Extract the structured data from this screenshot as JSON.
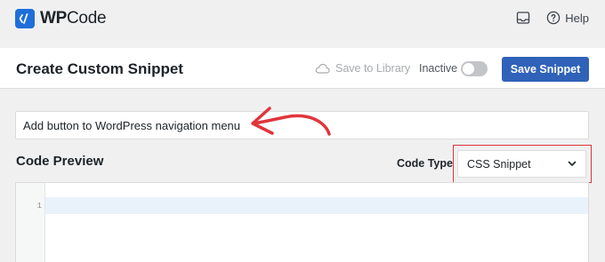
{
  "brand": {
    "prefix": "WP",
    "suffix": "Code",
    "accent": "#1e6fd9"
  },
  "topbar": {
    "inbox_icon": "inbox-icon",
    "help_icon": "question-circle-icon",
    "help_label": "Help"
  },
  "header": {
    "title": "Create Custom Snippet",
    "save_library_label": "Save to Library",
    "status_label": "Inactive",
    "active": false,
    "save_button_label": "Save Snippet",
    "save_button_color": "#2f62b8"
  },
  "snippet": {
    "title_value": "Add button to WordPress navigation menu"
  },
  "annotation": {
    "arrow_color": "#e0353b",
    "highlight_color": "#e0353b"
  },
  "code_preview": {
    "heading": "Code Preview",
    "code_type_label": "Code Type",
    "code_type_value": "CSS Snippet",
    "line_numbers": [
      "1"
    ]
  }
}
